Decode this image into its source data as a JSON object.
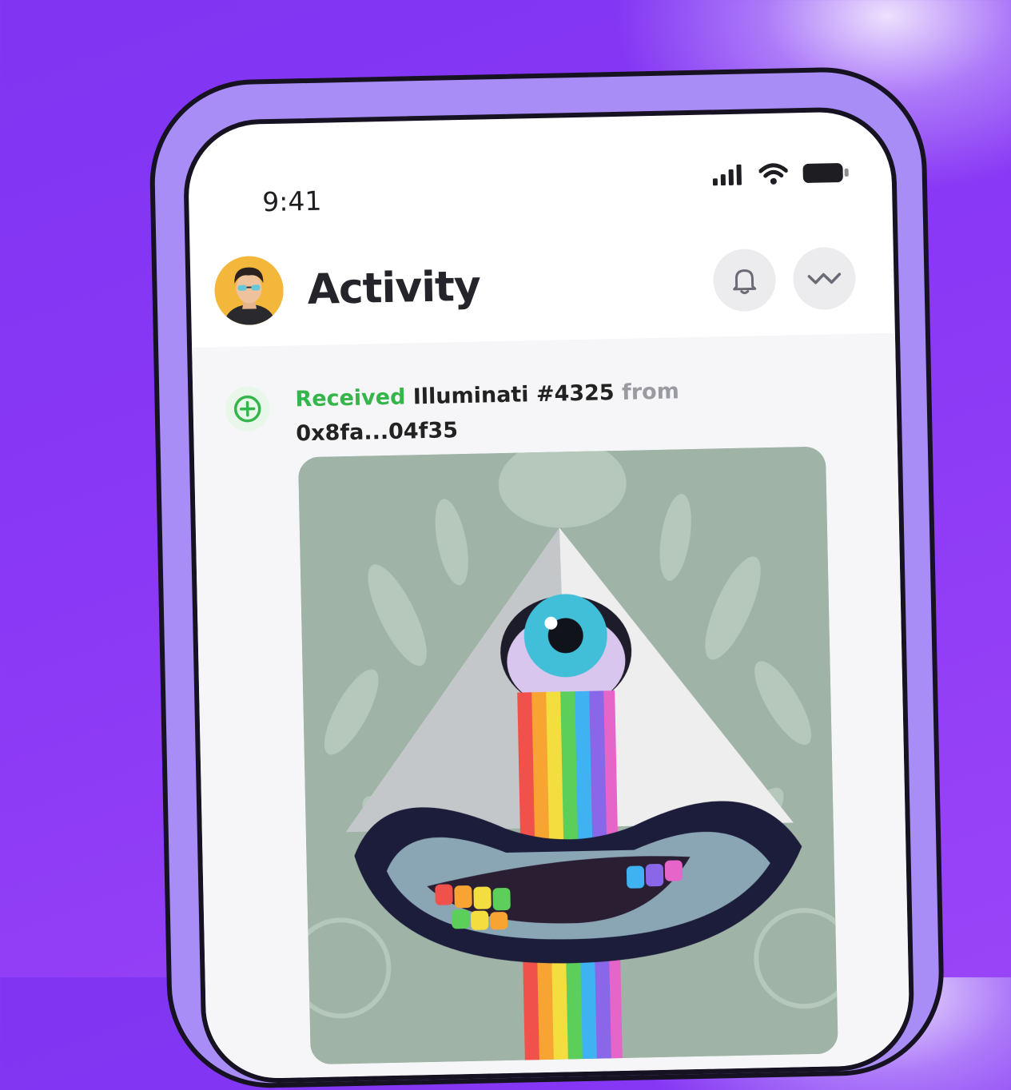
{
  "status_bar": {
    "time": "9:41"
  },
  "header": {
    "title": "Activity",
    "notifications_icon": "bell-icon",
    "connect_icon": "wallet-connect-icon"
  },
  "activity": {
    "verb": "Received",
    "item": "Illuminati #4325",
    "preposition": "from",
    "address": "0x8fa...04f35",
    "icon": "plus-circle-icon"
  },
  "colors": {
    "background": "#8a38f5",
    "phone_frame": "#a88df7",
    "received": "#35b54a"
  }
}
